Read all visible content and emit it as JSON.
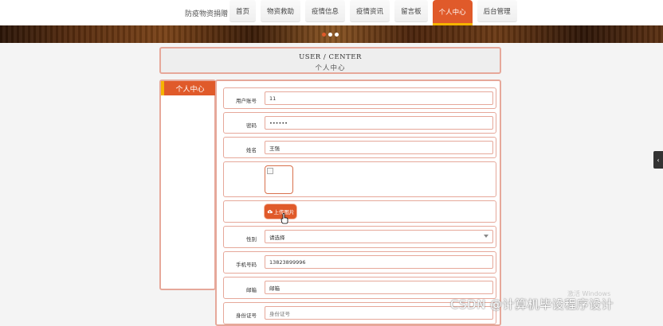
{
  "header": {
    "brand": "防疫物资捐赠",
    "nav": [
      {
        "label": "首页",
        "active": false
      },
      {
        "label": "物资救助",
        "active": false
      },
      {
        "label": "疫情信息",
        "active": false
      },
      {
        "label": "疫情资讯",
        "active": false
      },
      {
        "label": "留言板",
        "active": false
      },
      {
        "label": "个人中心",
        "active": true
      },
      {
        "label": "后台管理",
        "active": false
      }
    ]
  },
  "banner": {
    "slides": 3,
    "current_slide": 1
  },
  "page": {
    "title_en": "USER / CENTER",
    "title_zh": "个人中心"
  },
  "sidebar": {
    "tab_label": "个人中心"
  },
  "form": {
    "account_label": "用户账号",
    "account_value": "11",
    "password_label": "密码",
    "password_value": "••••••",
    "name_label": "姓名",
    "name_value": "王强",
    "upload_label": "上传图片",
    "gender_label": "性别",
    "gender_value": "请选择",
    "phone_label": "手机号码",
    "phone_value": "13823899996",
    "email_label": "邮箱",
    "email_value": "邮箱",
    "idcard_label": "身份证号",
    "idcard_placeholder": "身份证号"
  },
  "colors": {
    "accent": "#e05a2a",
    "accent_secondary": "#f5b400",
    "border": "#e6a89a"
  },
  "overlay": {
    "windows_watermark": "激活 Windows",
    "csdn_watermark": "CSDN @计算机毕设程序设计"
  }
}
